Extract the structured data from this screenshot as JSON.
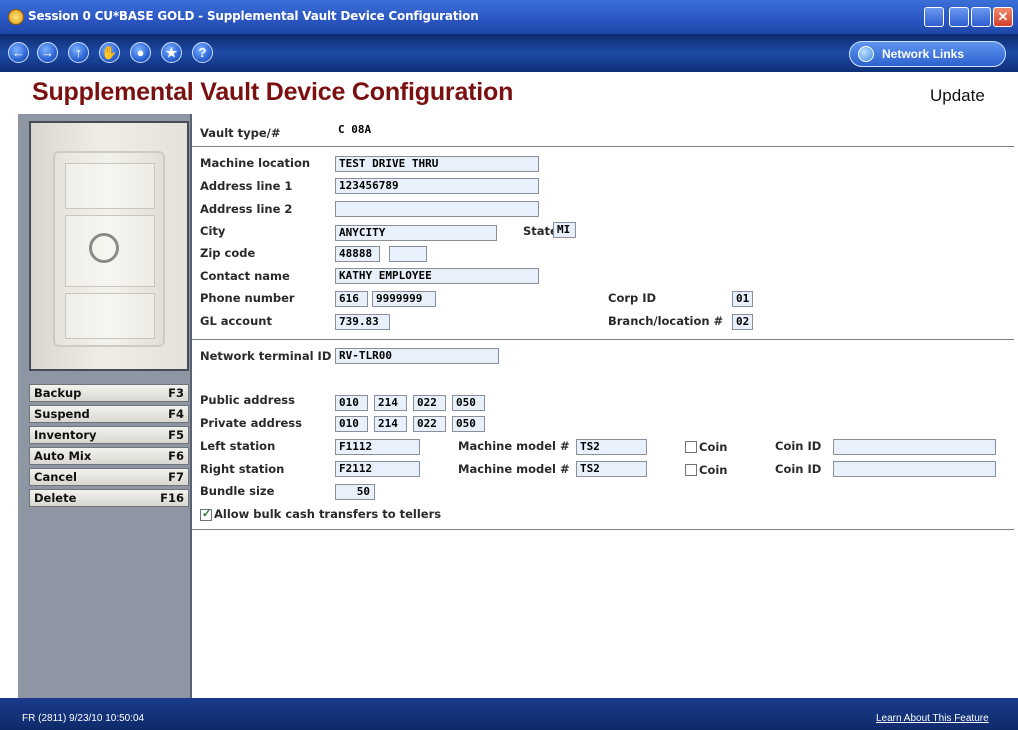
{
  "window": {
    "title": "Session 0 CU*BASE GOLD - Supplemental Vault Device Configuration"
  },
  "toolbar": {
    "network_links": "Network Links"
  },
  "header": {
    "title": "Supplemental Vault Device Configuration",
    "mode": "Update"
  },
  "function_keys": [
    {
      "label": "Backup",
      "key": "F3"
    },
    {
      "label": "Suspend",
      "key": "F4"
    },
    {
      "label": "Inventory",
      "key": "F5"
    },
    {
      "label": "Auto Mix",
      "key": "F6"
    },
    {
      "label": "Cancel",
      "key": "F7"
    },
    {
      "label": "Delete",
      "key": "F16"
    }
  ],
  "form": {
    "vault_type_label": "Vault type/#",
    "vault_type_value": "C  08A",
    "machine_location_label": "Machine location",
    "machine_location": "TEST DRIVE THRU",
    "address1_label": "Address line 1",
    "address1": "123456789",
    "address2_label": "Address line 2",
    "address2": "",
    "city_label": "City",
    "city": "ANYCITY",
    "state_label": "State",
    "state": "MI",
    "zip_label": "Zip code",
    "zip": "48888",
    "zip_ext": "",
    "contact_label": "Contact name",
    "contact": "KATHY EMPLOYEE",
    "phone_label": "Phone number",
    "phone_area": "616",
    "phone_number": "9999999",
    "corp_label": "Corp ID",
    "corp": "01",
    "gl_label": "GL account",
    "gl": "739.83",
    "branch_label": "Branch/location #",
    "branch": "02",
    "network_terminal_label": "Network terminal ID",
    "network_terminal": "RV-TLR00",
    "public_label": "Public address",
    "public_address": [
      "010",
      "214",
      "022",
      "050"
    ],
    "private_label": "Private address",
    "private_address": [
      "010",
      "214",
      "022",
      "050"
    ],
    "left_station_label": "Left station",
    "left_station": "F1112",
    "right_station_label": "Right station",
    "right_station": "F2112",
    "model_label": "Machine model #",
    "left_model": "TS2",
    "right_model": "TS2",
    "coin_label": "Coin",
    "coin_id_label": "Coin ID",
    "left_coin_id": "",
    "right_coin_id": "",
    "bundle_label": "Bundle size",
    "bundle": "50",
    "bulk_label": "Allow bulk cash transfers to tellers",
    "bulk_checked": true
  },
  "status": {
    "left": "FR (2811) 9/23/10 10:50:04",
    "right": "Learn About This Feature"
  }
}
